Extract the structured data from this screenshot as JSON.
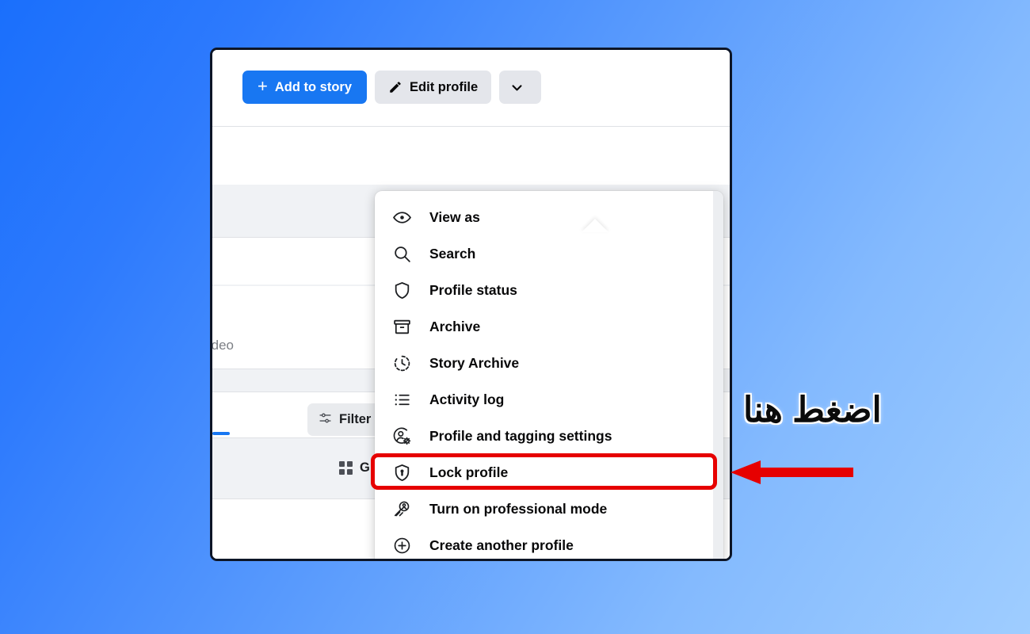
{
  "background": {
    "gradient_from": "#1a6ffc",
    "gradient_to": "#9fcdff"
  },
  "window": {
    "border_color": "#0d1526",
    "action_bar": {
      "add_to_story": {
        "label": "Add to story",
        "icon": "plus-icon",
        "color": "#1877f2"
      },
      "edit_profile": {
        "label": "Edit profile",
        "icon": "pencil-icon",
        "color": "#e4e6eb"
      },
      "more_chevron": {
        "label": "",
        "icon": "chevron-down-icon"
      }
    },
    "page_content": {
      "composer_text": "oto/video",
      "filter_label": "Filter",
      "filter_icon": "sliders-icon",
      "grid_label": "Gr",
      "grid_icon": "grid-icon"
    },
    "more_options_button": {
      "icon": "ellipsis-icon",
      "label": ""
    }
  },
  "menu": {
    "scrollbar_color": "#eceef1",
    "items": [
      {
        "label": "View as",
        "icon": "eye-icon",
        "highlighted": false
      },
      {
        "label": "Search",
        "icon": "magnifier-icon",
        "highlighted": false
      },
      {
        "label": "Profile status",
        "icon": "shield-icon",
        "highlighted": false
      },
      {
        "label": "Archive",
        "icon": "archive-box-icon",
        "highlighted": false
      },
      {
        "label": "Story Archive",
        "icon": "clock-history-icon",
        "highlighted": false
      },
      {
        "label": "Activity log",
        "icon": "list-icon",
        "highlighted": false
      },
      {
        "label": "Profile and tagging settings",
        "icon": "person-gear-icon",
        "highlighted": false
      },
      {
        "label": "Lock profile",
        "icon": "shield-lock-icon",
        "highlighted": true
      },
      {
        "label": "Turn on professional mode",
        "icon": "rocket-person-icon",
        "highlighted": false
      },
      {
        "label": "Create another profile",
        "icon": "plus-circle-icon",
        "highlighted": false
      }
    ]
  },
  "annotation": {
    "text": "اضغط هنا",
    "text_color": "#0b0b0b",
    "outline_color": "#ffffff",
    "arrow_color": "#e60000",
    "highlight_color": "#e60000",
    "highlight_target": "Lock profile"
  }
}
